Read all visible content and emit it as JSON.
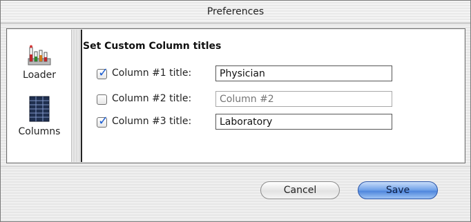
{
  "window": {
    "title": "Preferences"
  },
  "sidebar": {
    "items": [
      {
        "label": "Loader",
        "icon": "test-tube-rack-icon"
      },
      {
        "label": "Columns",
        "icon": "columns-grid-icon"
      }
    ]
  },
  "pane": {
    "title": "Set Custom Column titles",
    "rows": [
      {
        "label": "Column #1 title:",
        "checked": true,
        "value": "Physician",
        "placeholder": "",
        "enabled": true
      },
      {
        "label": "Column #2 title:",
        "checked": false,
        "value": "",
        "placeholder": "Column #2",
        "enabled": false
      },
      {
        "label": "Column #3 title:",
        "checked": true,
        "value": "Laboratory",
        "placeholder": "",
        "enabled": true
      }
    ],
    "checkmark": "✓"
  },
  "buttons": {
    "cancel": "Cancel",
    "save": "Save"
  },
  "colors": {
    "accent": "#4f86dd",
    "check": "#1f5fd1"
  }
}
